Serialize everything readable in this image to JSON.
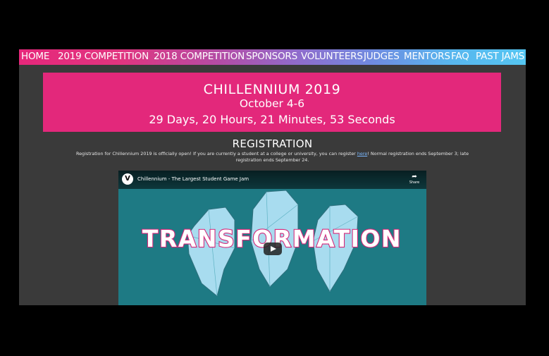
{
  "nav": {
    "items": [
      {
        "label": "HOME"
      },
      {
        "label": "2019 COMPETITION"
      },
      {
        "label": "2018 COMPETITION"
      },
      {
        "label": "SPONSORS"
      },
      {
        "label": "VOLUNTEERS"
      },
      {
        "label": "JUDGES"
      },
      {
        "label": "MENTORS"
      },
      {
        "label": "FAQ"
      },
      {
        "label": "PAST JAMS"
      }
    ]
  },
  "banner": {
    "title": "CHILLENNIUM 2019",
    "dates": "October 4-6",
    "countdown": "29 Days, 20 Hours, 21 Minutes, 53 Seconds"
  },
  "registration": {
    "heading": "REGISTRATION",
    "text_before": "Registration for Chillennium 2019 is officially open! If you are currently a student at a college or university, you can register ",
    "link_label": "here",
    "text_after": "! Normal registration ends September 3; late registration ends September 24."
  },
  "video": {
    "channel_logo": "V",
    "title": "Chillennium - The Largest Student Game Jam",
    "share_label": "Share",
    "overlay_text": "TRANSFORMATION",
    "colors": {
      "background": "#1e7a84",
      "crystal": "#a8dcef",
      "text": "#ffffff",
      "text_outline": "#d4287a"
    }
  },
  "colors": {
    "accent_pink": "#e3287b",
    "page_bg": "#3a3a3a",
    "nav_end": "#55c6f2"
  }
}
